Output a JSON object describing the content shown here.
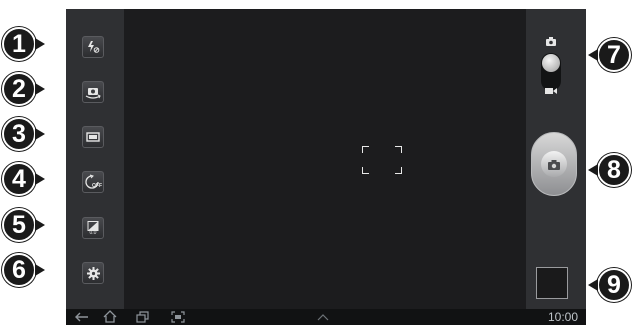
{
  "callouts": [
    "1",
    "2",
    "3",
    "4",
    "5",
    "6",
    "7",
    "8",
    "9"
  ],
  "left_buttons": [
    {
      "name": "flash-off-button",
      "icon": "flash-off-icon"
    },
    {
      "name": "self-portrait-button",
      "icon": "switch-camera-icon"
    },
    {
      "name": "shooting-mode-button",
      "icon": "shooting-mode-icon"
    },
    {
      "name": "timer-button",
      "icon": "timer-off-icon",
      "label": "OFF"
    },
    {
      "name": "exposure-button",
      "icon": "exposure-icon",
      "value": "0.0"
    },
    {
      "name": "settings-button",
      "icon": "gear-icon"
    }
  ],
  "status_bar": {
    "time": "10:00"
  },
  "colors": {
    "panel": "#2f3033",
    "viewfinder": "#1c1c1e",
    "callout": "#1a1a1a"
  }
}
